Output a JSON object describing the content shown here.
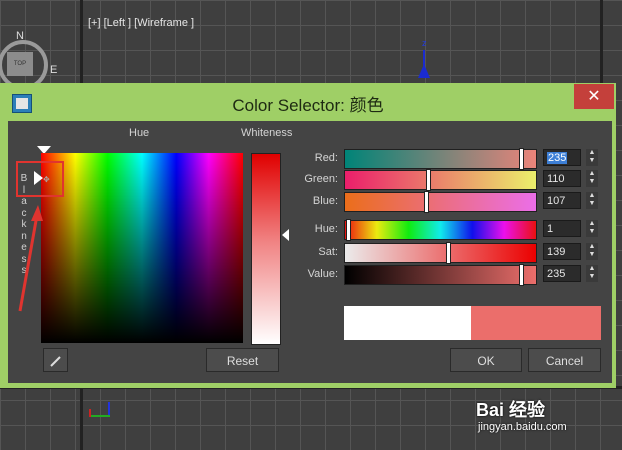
{
  "viewport": {
    "label": "[+] [Left ] [Wireframe ]",
    "viewcube_top": "TOP",
    "viewcube_n": "N",
    "viewcube_e": "E",
    "axis_z": "z"
  },
  "dialog": {
    "title": "Color Selector: 颜色",
    "close_label": "✕",
    "hue_header": "Hue",
    "whiteness_header": "Whiteness",
    "blackness_label": "Blackness",
    "blackness_letters": [
      "B",
      "l",
      "a",
      "c",
      "k",
      "n",
      "e",
      "s",
      "s"
    ],
    "rows": [
      {
        "label": "Red:",
        "value": "235",
        "selected": true
      },
      {
        "label": "Green:",
        "value": "110",
        "selected": false
      },
      {
        "label": "Blue:",
        "value": "107",
        "selected": false
      },
      {
        "label": "Hue:",
        "value": "1",
        "selected": false
      },
      {
        "label": "Sat:",
        "value": "139",
        "selected": false
      },
      {
        "label": "Value:",
        "value": "235",
        "selected": false
      }
    ],
    "reset_label": "Reset",
    "ok_label": "OK",
    "cancel_label": "Cancel",
    "old_color": "#ffffff",
    "new_color": "#eb6e6b"
  },
  "watermark": {
    "brand": "Bai 经验",
    "url": "jingyan.baidu.com"
  },
  "icons": [
    "app-icon",
    "close-icon",
    "eyedropper-icon",
    "spin-up-icon",
    "spin-down-icon",
    "annotation-arrow"
  ]
}
